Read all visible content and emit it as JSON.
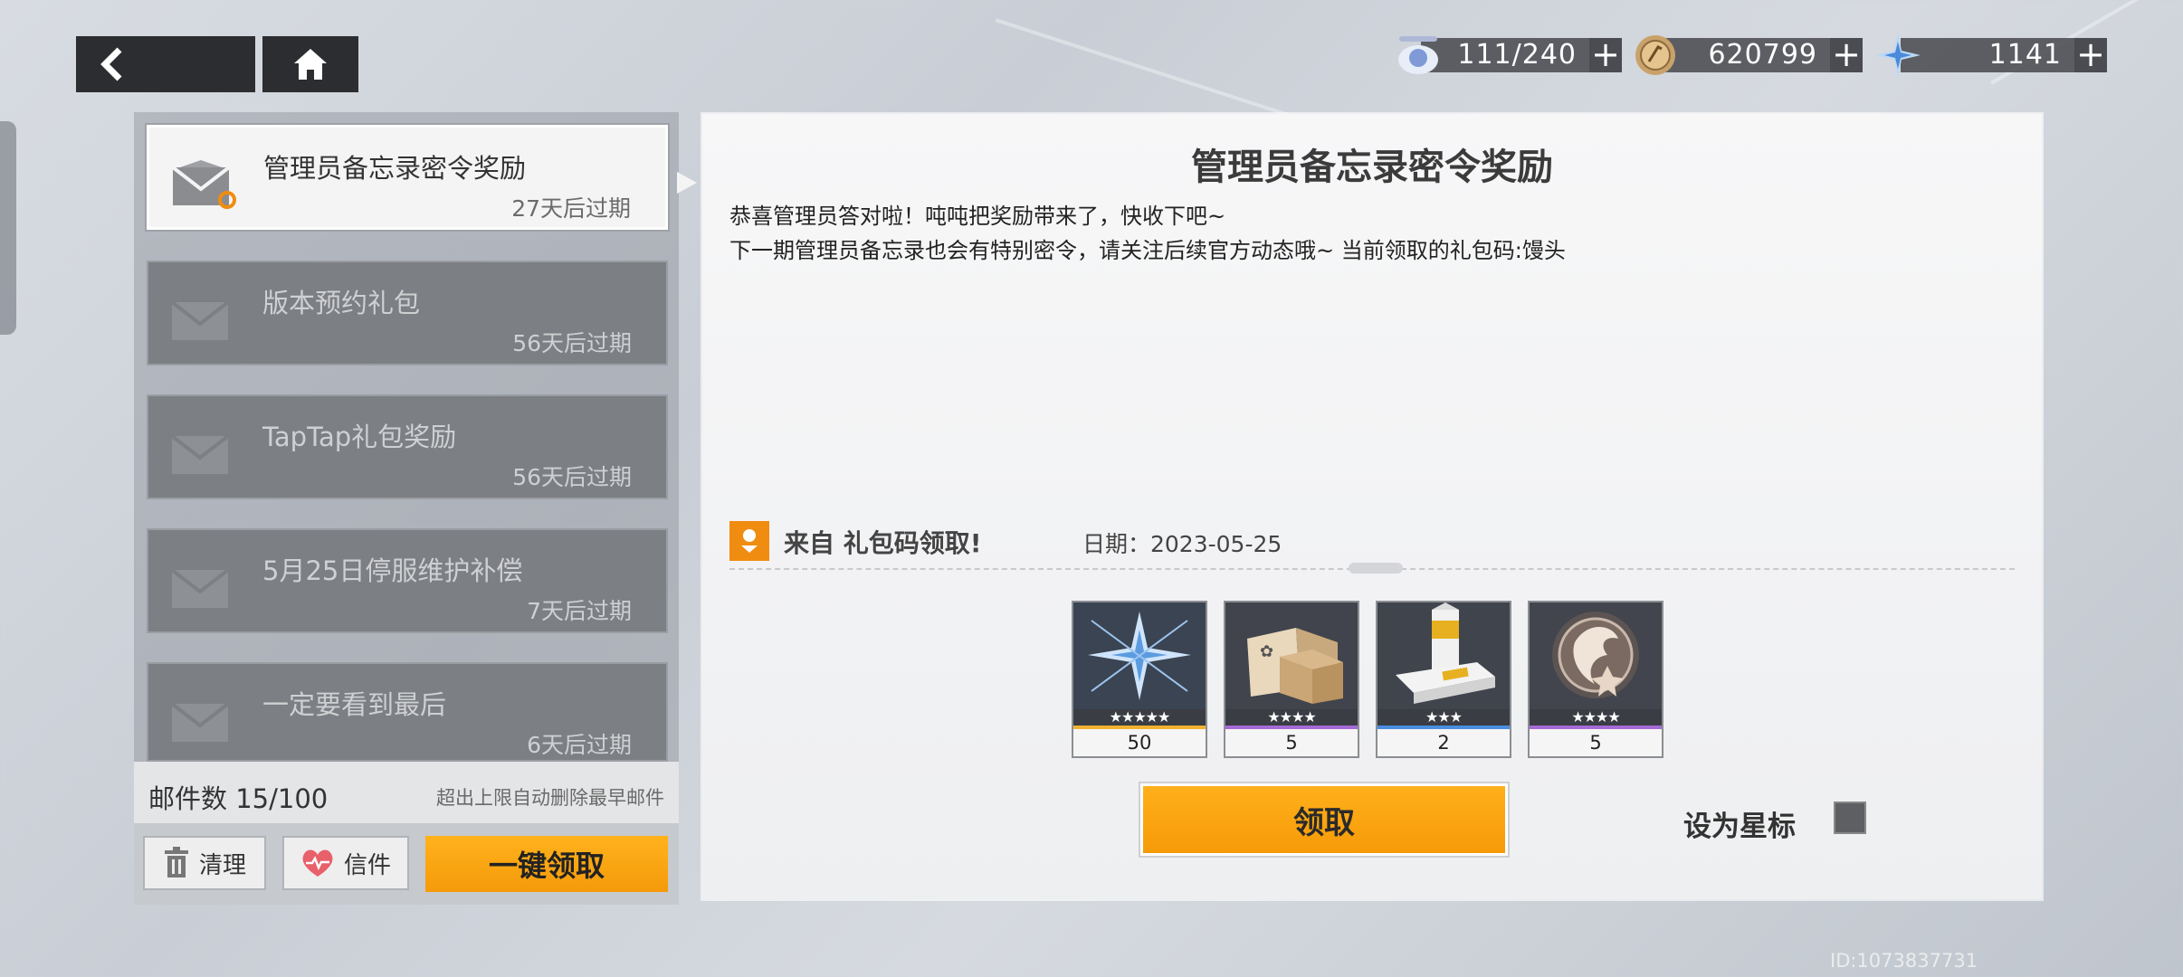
{
  "resources": [
    {
      "icon": "stamina-drone-icon",
      "value": "111/240"
    },
    {
      "icon": "coin-icon",
      "value": "620799"
    },
    {
      "icon": "crystal-icon",
      "value": "1141"
    }
  ],
  "mail_list": [
    {
      "title": "管理员备忘录密令奖励",
      "expiry": "27天后过期",
      "active": true
    },
    {
      "title": "版本预约礼包",
      "expiry": "56天后过期",
      "active": false
    },
    {
      "title": "TapTap礼包奖励",
      "expiry": "56天后过期",
      "active": false
    },
    {
      "title": "5月25日停服维护补偿",
      "expiry": "7天后过期",
      "active": false
    },
    {
      "title": "一定要看到最后",
      "expiry": "6天后过期",
      "active": false
    }
  ],
  "footer": {
    "count_label": "邮件数 15/100",
    "auto_delete_note": "超出上限自动删除最早邮件",
    "clear_label": "清理",
    "letters_label": "信件",
    "claim_all_label": "一键领取"
  },
  "detail": {
    "title": "管理员备忘录密令奖励",
    "body_line1": "恭喜管理员答对啦！吨吨把奖励带来了，快收下吧~",
    "body_line2": "下一期管理员备忘录也会有特别密令，请关注后续官方动态哦~ 当前领取的礼包码:馒头",
    "from_label": "来自 礼包码领取!",
    "date_label": "日期：2023-05-25",
    "claim_label": "领取",
    "star_label": "设为星标",
    "items": [
      {
        "name": "crystal-item",
        "stars": "★★★★★",
        "qty": "50"
      },
      {
        "name": "supply-box-item",
        "stars": "★★★★",
        "qty": "5"
      },
      {
        "name": "drink-item",
        "stars": "★★★",
        "qty": "2"
      },
      {
        "name": "chip-item",
        "stars": "★★★★",
        "qty": "5"
      }
    ]
  },
  "uid": "ID:1073837731",
  "colors": {
    "accent": "#f59a0a",
    "panel": "#f4f4f4",
    "dark": "#2c2d30"
  }
}
